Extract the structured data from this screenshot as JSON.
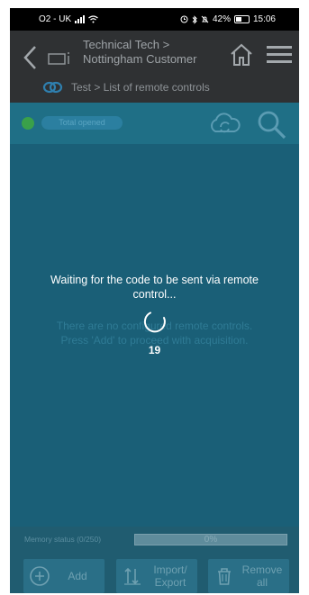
{
  "status_bar": {
    "carrier": "O2 - UK",
    "battery": "42%",
    "time": "15:06"
  },
  "header": {
    "title_line1": "Technical Tech >",
    "title_line2": "Nottingham Customer",
    "subtitle": "Test > List of remote controls"
  },
  "toolbar": {
    "pill_label": "Total opened"
  },
  "content": {
    "empty_line1": "There are no configured remote controls.",
    "empty_line2": "Press 'Add' to proceed with acquisition.",
    "waiting_line1": "Waiting for the code to be sent via remote",
    "waiting_line2": "control...",
    "countdown": "19"
  },
  "footer": {
    "memory_label": "Memory status (0/250)",
    "memory_percent": "0%",
    "memory_fraction": 0,
    "add_label": "Add",
    "import_line1": "Import/",
    "import_line2": "Export",
    "remove_line1": "Remove",
    "remove_line2": "all"
  },
  "colors": {
    "header_bg": "#2f3133",
    "content_bg": "#1a5f77",
    "status_dot": "#3aa04a"
  },
  "icons": [
    "back-icon",
    "device-icon",
    "home-icon",
    "menu-icon",
    "link-icon",
    "cloud-sync-icon",
    "search-icon",
    "spinner-icon",
    "add-icon",
    "import-export-icon",
    "trash-icon"
  ]
}
